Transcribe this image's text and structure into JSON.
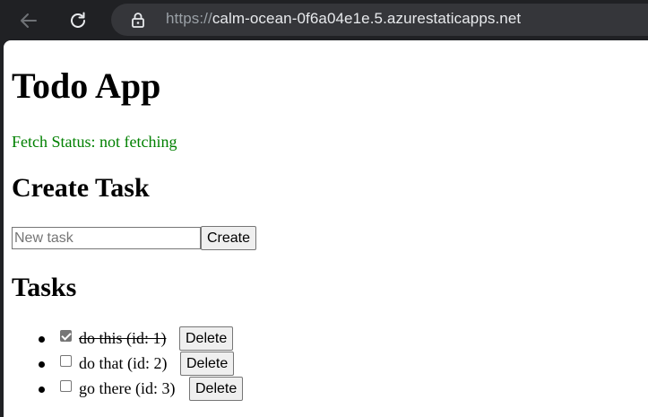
{
  "browser": {
    "url_scheme": "https://",
    "url_host": "calm-ocean-0f6a04e1e.5.azurestaticapps.net"
  },
  "page": {
    "title": "Todo App",
    "fetch_status": "Fetch Status: not fetching",
    "create_heading": "Create Task",
    "task_input_placeholder": "New task",
    "task_input_value": "",
    "create_button": "Create",
    "tasks_heading": "Tasks",
    "tasks": [
      {
        "text": "do this (id: 1)",
        "completed": true,
        "delete_label": "Delete"
      },
      {
        "text": "do that (id: 2)",
        "completed": false,
        "delete_label": "Delete"
      },
      {
        "text": "go there (id: 3)",
        "completed": false,
        "delete_label": "Delete"
      }
    ]
  }
}
